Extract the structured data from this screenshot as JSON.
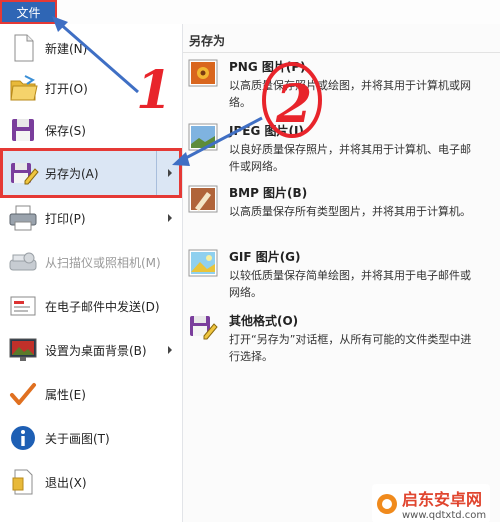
{
  "file_tab": {
    "label": "文件"
  },
  "menu": {
    "items": [
      {
        "label": "新建(N)",
        "icon": "new-document-icon",
        "disabled": false
      },
      {
        "label": "打开(O)",
        "icon": "open-folder-icon",
        "disabled": false
      },
      {
        "label": "保存(S)",
        "icon": "save-icon",
        "disabled": false
      },
      {
        "label": "另存为(A)",
        "icon": "save-as-icon",
        "disabled": false,
        "has_submenu": true
      },
      {
        "label": "打印(P)",
        "icon": "printer-icon",
        "disabled": false,
        "has_submenu": true
      },
      {
        "label": "从扫描仪或照相机(M)",
        "icon": "scanner-icon",
        "disabled": true
      },
      {
        "label": "在电子邮件中发送(D)",
        "icon": "email-icon",
        "disabled": false
      },
      {
        "label": "设置为桌面背景(B)",
        "icon": "desktop-background-icon",
        "disabled": false,
        "has_submenu": true
      },
      {
        "label": "属性(E)",
        "icon": "checkmark-icon",
        "disabled": false
      },
      {
        "label": "关于画图(T)",
        "icon": "info-icon",
        "disabled": false
      },
      {
        "label": "退出(X)",
        "icon": "exit-icon",
        "disabled": false
      }
    ]
  },
  "submenu": {
    "title": "另存为",
    "items": [
      {
        "title": "PNG 图片(P)",
        "desc": "以高质量保存照片或绘图，并将其用于计算机或网络。",
        "icon": "png-image-icon"
      },
      {
        "title": "JPEG 图片(J)",
        "desc": "以良好质量保存照片，并将其用于计算机、电子邮件或网络。",
        "icon": "jpeg-image-icon"
      },
      {
        "title": "BMP 图片(B)",
        "desc": "以高质量保存所有类型图片，并将其用于计算机。",
        "icon": "bmp-image-icon"
      },
      {
        "title": "GIF 图片(G)",
        "desc": "以较低质量保存简单绘图，并将其用于电子邮件或网络。",
        "icon": "gif-image-icon"
      },
      {
        "title": "其他格式(O)",
        "desc": "打开“另存为”对话框，从所有可能的文件类型中进行选择。",
        "icon": "other-formats-icon"
      }
    ]
  },
  "annotations": {
    "mark1": "1",
    "mark2": "2"
  },
  "watermark": {
    "name": "启东安卓网",
    "url": "www.qdtxtd.com"
  },
  "colors": {
    "file_tab": "#2f66b5",
    "highlight_border": "#e53935",
    "selection_bg": "#dbe6f4",
    "annotation": "#e8242b",
    "arrow": "#3f6fc4"
  }
}
